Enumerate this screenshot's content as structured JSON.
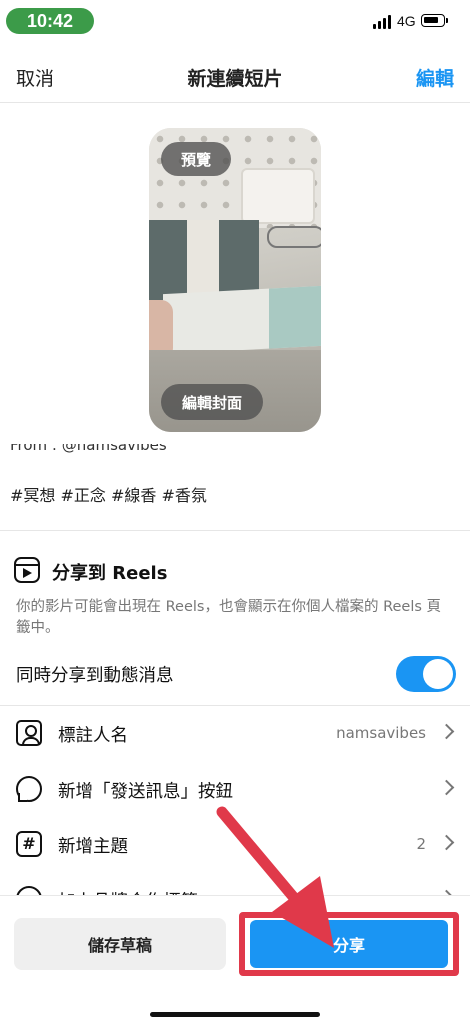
{
  "status_bar": {
    "time": "10:42",
    "network": "4G"
  },
  "header": {
    "cancel": "取消",
    "title": "新連續短片",
    "edit": "編輯"
  },
  "preview": {
    "preview_label": "預覽",
    "edit_cover_label": "編輯封面"
  },
  "caption": {
    "partial_line": "From : @namsavibes",
    "hashtags": "#冥想 #正念 #線香 #香氛"
  },
  "reels": {
    "title": "分享到 Reels",
    "description": "你的影片可能會出現在 Reels，也會顯示在你個人檔案的 Reels 頁籤中。"
  },
  "share_to_feed": {
    "label": "同時分享到動態消息",
    "enabled": true
  },
  "options": [
    {
      "label": "標註人名",
      "value": "namsavibes",
      "icon": "person-tag-icon"
    },
    {
      "label": "新增「發送訊息」按鈕",
      "value": "",
      "icon": "message-bubble-icon"
    },
    {
      "label": "新增主題",
      "value": "2",
      "icon": "hashtag-icon"
    },
    {
      "label": "加上品牌合作標籤",
      "value": "",
      "icon": "brand-icon"
    }
  ],
  "bottom": {
    "draft_label": "儲存草稿",
    "share_label": "分享"
  },
  "colors": {
    "accent": "#1a95f3",
    "highlight_red": "#e0394a",
    "time_pill": "#3c9b49"
  }
}
